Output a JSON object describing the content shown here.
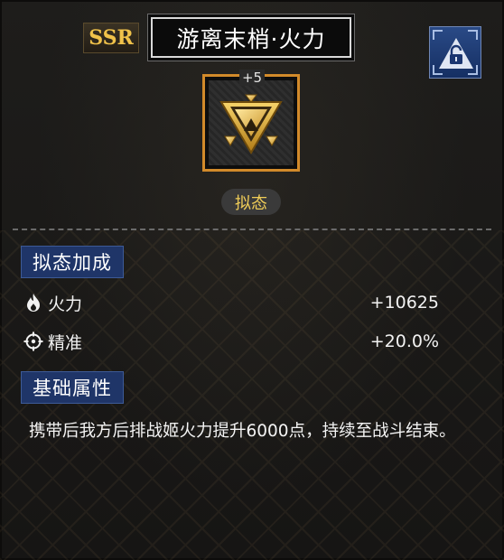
{
  "item": {
    "rarity": "SSR",
    "name": "游离末梢·火力",
    "level": "+5",
    "type": "拟态"
  },
  "icons": {
    "lock": "lock-icon",
    "item": "triangle-gem-icon",
    "fire": "flame-icon",
    "accuracy": "crosshair-icon"
  },
  "sections": {
    "mimic_bonus": {
      "title": "拟态加成",
      "stats": [
        {
          "label": "火力",
          "value": "+10625"
        },
        {
          "label": "精准",
          "value": "+20.0%"
        }
      ]
    },
    "base_attributes": {
      "title": "基础属性",
      "description": "携带后我方后排战姬火力提升6000点，持续至战斗结束。"
    }
  },
  "colors": {
    "rarity_gold": "#f0c24a",
    "frame_orange": "#d28a2a",
    "section_blue": "#1f3568",
    "type_text": "#f0cd58"
  }
}
